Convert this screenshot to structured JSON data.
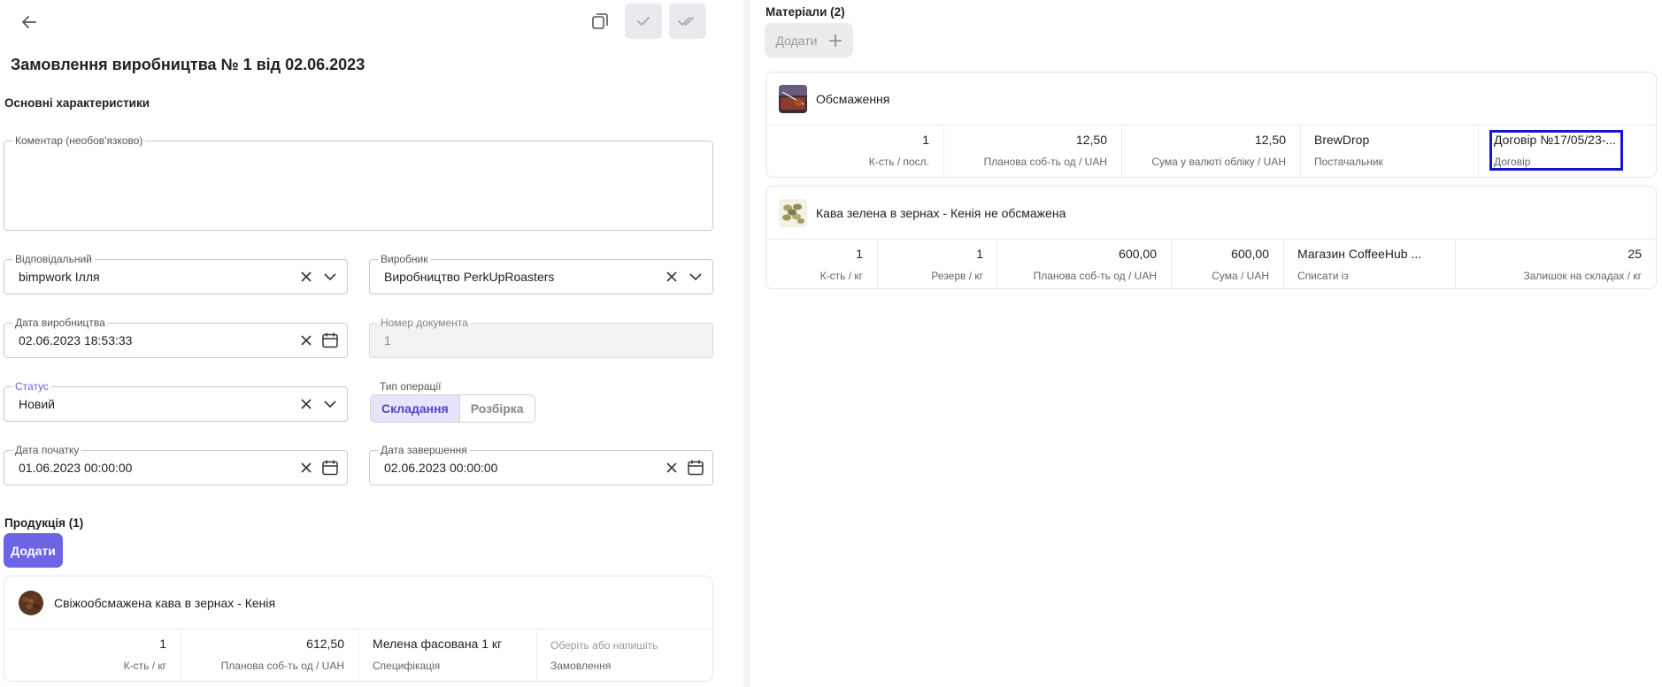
{
  "page": {
    "title": "Замовлення виробництва № 1 від 02.06.2023",
    "main_section": "Основні характеристики"
  },
  "form": {
    "comment_label": "Коментар (необов'язково)",
    "comment_value": "",
    "responsible_label": "Відповідальний",
    "responsible_value": "bimpwork Ілля",
    "producer_label": "Виробник",
    "producer_value": "Виробництво PerkUpRoasters",
    "prod_date_label": "Дата виробництва",
    "prod_date_value": "02.06.2023 18:53:33",
    "docnum_label": "Номер документа",
    "docnum_value": "1",
    "status_label": "Статус",
    "status_value": "Новий",
    "optype_label": "Тип операції",
    "optype_options": [
      "Складання",
      "Розбірка"
    ],
    "start_label": "Дата початку",
    "start_value": "01.06.2023 00:00:00",
    "end_label": "Дата завершення",
    "end_value": "02.06.2023 00:00:00"
  },
  "production": {
    "title": "Продукція (1)",
    "add_label": "Додати",
    "item": {
      "name": "Свіжообсмажена кава в зернах - Кенія",
      "qty": "1",
      "qty_label": "К-сть / кг",
      "cost": "612,50",
      "cost_label": "Планова соб-ть од / UAH",
      "spec": "Мелена фасована 1 кг",
      "spec_label": "Специфікація",
      "order_placeholder": "Оберіть або напишіть",
      "order_label": "Замовлення"
    }
  },
  "materials": {
    "title": "Матеріали (2)",
    "add_label": "Додати",
    "items": [
      {
        "name": "Обсмаження",
        "qty": "1",
        "qty_label": "К-сть / посл.",
        "cost": "12,50",
        "cost_label": "Планова соб-ть од / UAH",
        "sum": "12,50",
        "sum_label": "Сума у валюті обліку / UAH",
        "supplier": "BrewDrop",
        "supplier_label": "Постачальник",
        "contract": "Договір №17/05/23-...",
        "contract_label": "Договір"
      },
      {
        "name": "Кава зелена в зернах - Кенія не обсмажена",
        "qty": "1",
        "qty_label": "К-сть / кг",
        "reserve": "1",
        "reserve_label": "Резерв / кг",
        "cost": "600,00",
        "cost_label": "Планова соб-ть од / UAH",
        "sum": "600,00",
        "sum_label": "Сума / UAH",
        "writeoff": "Магазин CoffeeHub ...",
        "writeoff_label": "Списати із",
        "stock": "25",
        "stock_label": "Залишок на складах / кг"
      }
    ]
  },
  "colors": {
    "accent": "#6c63e6",
    "highlight": "#1515d4"
  }
}
